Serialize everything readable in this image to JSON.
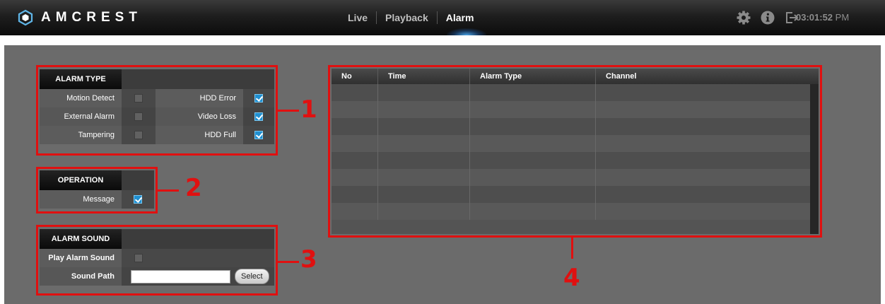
{
  "app": {
    "logo_text": "AMCREST"
  },
  "nav": {
    "items": [
      "Live",
      "Playback",
      "Alarm"
    ],
    "active": "Alarm"
  },
  "toolbar": {
    "icons": [
      "gear-icon",
      "info-icon",
      "logout-icon"
    ],
    "time": "03:01:52",
    "ampm": "PM"
  },
  "alarm_type": {
    "title": "ALARM TYPE",
    "rows": [
      {
        "left_label": "Motion Detect",
        "left_checked": false,
        "right_label": "HDD Error",
        "right_checked": true
      },
      {
        "left_label": "External Alarm",
        "left_checked": false,
        "right_label": "Video Loss",
        "right_checked": true
      },
      {
        "left_label": "Tampering",
        "left_checked": false,
        "right_label": "HDD Full",
        "right_checked": true
      }
    ]
  },
  "operation": {
    "title": "OPERATION",
    "message_label": "Message",
    "message_checked": true
  },
  "alarm_sound": {
    "title": "ALARM SOUND",
    "play_label": "Play Alarm Sound",
    "play_checked": false,
    "path_label": "Sound Path",
    "path_value": "",
    "select_label": "Select"
  },
  "alarm_table": {
    "columns": [
      "No",
      "Time",
      "Alarm Type",
      "Channel"
    ],
    "row_count": 8
  },
  "annotations": {
    "markers": [
      "1",
      "2",
      "3",
      "4"
    ],
    "color": "#e01010"
  },
  "colors": {
    "accent": "#1f8fd1",
    "annotation": "#e01010"
  }
}
